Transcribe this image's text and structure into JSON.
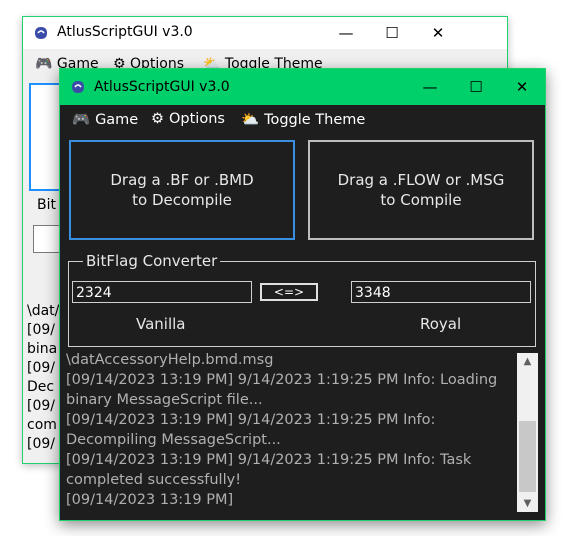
{
  "back_window": {
    "title": "AtlusScriptGUI v3.0",
    "menu": {
      "game": "Game",
      "options": "Options",
      "toggle_theme": "Toggle Theme"
    },
    "bitflag_partial": "Bit",
    "log_partial": [
      "\\dat/",
      "[09/",
      "bina",
      "[09/",
      "Dec",
      "[09/",
      "com",
      "[09/"
    ]
  },
  "front_window": {
    "title": "AtlusScriptGUI v3.0",
    "controls": {
      "minimize": "—",
      "maximize": "☐",
      "close": "✕"
    },
    "menu": {
      "game": "Game",
      "options": "Options",
      "toggle_theme": "Toggle Theme"
    },
    "drop_decompile": {
      "line1": "Drag a .BF or .BMD",
      "line2": "to Decompile"
    },
    "drop_compile": {
      "line1": "Drag a .FLOW or .MSG",
      "line2": "to Compile"
    },
    "bitflag": {
      "legend": "BitFlag Converter",
      "vanilla_value": "2324",
      "royal_value": "3348",
      "convert_label": "<=>",
      "vanilla_label": "Vanilla",
      "royal_label": "Royal"
    },
    "log": [
      "\\datAccessoryHelp.bmd.msg",
      "[09/14/2023 13:19 PM] 9/14/2023 1:19:25 PM  Info: Loading",
      "binary MessageScript file...",
      "[09/14/2023 13:19 PM] 9/14/2023 1:19:25 PM  Info:",
      "Decompiling MessageScript...",
      "[09/14/2023 13:19 PM] 9/14/2023 1:19:25 PM  Info: Task",
      "completed successfully!",
      "[09/14/2023 13:19 PM]"
    ]
  },
  "colors": {
    "accent_green": "#00d06a",
    "dark_bg": "#1e1e1e",
    "focus_blue": "#3b8fe0"
  },
  "icons": {
    "game": "gamepad-icon",
    "options": "gear-icon",
    "theme": "sun-cloud-icon"
  }
}
